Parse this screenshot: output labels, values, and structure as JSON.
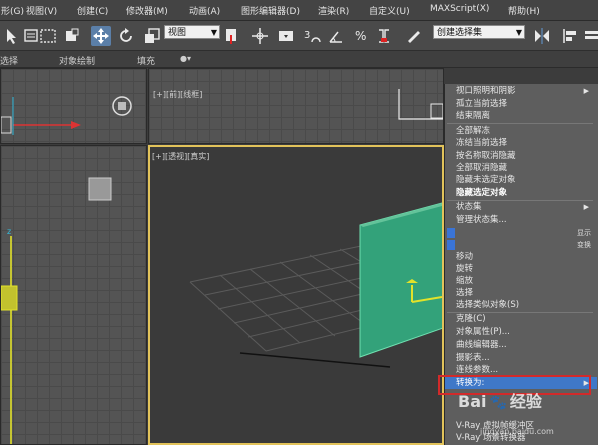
{
  "menubar": {
    "items": [
      "形(G)",
      "视图(V)",
      "创建(C)",
      "修改器(M)",
      "动画(A)",
      "图形编辑器(D)",
      "渲染(R)",
      "自定义(U)",
      "MAXScript(X)",
      "帮助(H)"
    ]
  },
  "toolbar": {
    "view_dropdown": "视图",
    "selection_set_dropdown": "创建选择集",
    "snap_label": "3",
    "percent_label": "%",
    "icons": [
      "move-icon",
      "rotate-icon",
      "scale-icon",
      "snap-icon",
      "angle-snap-icon",
      "percent-snap-icon",
      "spinner-snap-icon",
      "mirror-icon",
      "align-icon"
    ]
  },
  "ribbon": {
    "tabs": [
      "选择",
      "对象绘制",
      "填充"
    ]
  },
  "viewports": {
    "top_label": "[+][前][线框]",
    "persp_label": "[+][透视][真实]"
  },
  "context_menu": {
    "items": [
      {
        "label": "视口照明和阴影",
        "submenu": true
      },
      {
        "label": "孤立当前选择"
      },
      {
        "label": "结束隔离"
      },
      {
        "label": "全部解冻"
      },
      {
        "label": "冻结当前选择"
      },
      {
        "label": "按名称取消隐藏"
      },
      {
        "label": "全部取消隐藏"
      },
      {
        "label": "隐藏未选定对象"
      },
      {
        "label": "隐藏选定对象",
        "bold": true
      },
      {
        "label": "状态集",
        "submenu": true
      },
      {
        "label": "管理状态集..."
      },
      {
        "label": "移动"
      },
      {
        "label": "旋转"
      },
      {
        "label": "缩放"
      },
      {
        "label": "选择"
      },
      {
        "label": "选择类似对象(S)"
      },
      {
        "label": "克隆(C)"
      },
      {
        "label": "对象属性(P)..."
      },
      {
        "label": "曲线编辑器..."
      },
      {
        "label": "摄影表..."
      },
      {
        "label": "连线参数..."
      },
      {
        "label": "转换为:",
        "submenu": true,
        "highlighted": true
      },
      {
        "label": "V-Ray 虚拟帧缓冲区"
      },
      {
        "label": "V-Ray 场景转换器"
      }
    ],
    "side_labels": [
      "显示",
      "变换"
    ]
  },
  "watermark": {
    "brand": "Bai",
    "brand2": "经验",
    "url": "jingyan.baidu.com"
  },
  "colors": {
    "menu_bg": "#5e5e5e",
    "highlight": "#3f78c8",
    "red_box": "#d22a2a",
    "box_green": "#33a27a",
    "viewport_active_border": "#e2c35a"
  }
}
